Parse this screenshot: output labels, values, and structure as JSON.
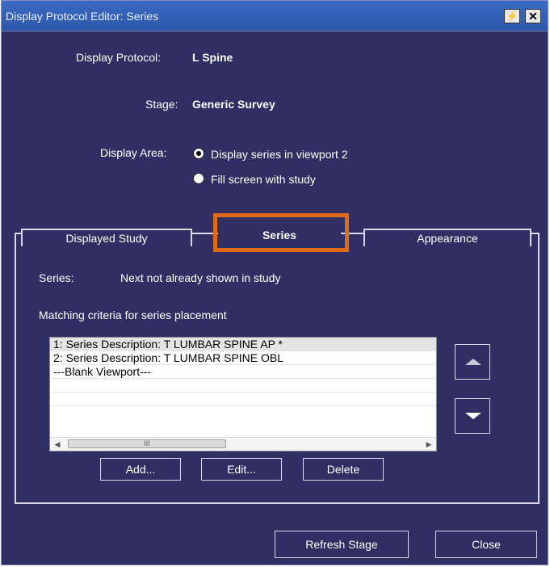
{
  "window": {
    "title": "Display Protocol Editor: Series",
    "help_glyph": "⚡",
    "close_glyph": "✕"
  },
  "protocol": {
    "display_protocol_label": "Display Protocol:",
    "display_protocol_value": "L Spine",
    "stage_label": "Stage:",
    "stage_value": "Generic Survey",
    "display_area_label": "Display Area:",
    "options": [
      {
        "label": "Display series in viewport 2",
        "selected": true
      },
      {
        "label": "Fill screen with study",
        "selected": false
      }
    ]
  },
  "tabs": [
    {
      "label": "Displayed Study",
      "active": false
    },
    {
      "label": "Series",
      "active": true
    },
    {
      "label": "Appearance",
      "active": false
    }
  ],
  "series_panel": {
    "series_label": "Series:",
    "series_value": "Next not already shown in study",
    "criteria_heading": "Matching criteria for series placement",
    "list_items": [
      "1: Series Description: T LUMBAR SPINE AP *",
      "2: Series Description: T LUMBAR SPINE OBL",
      "---Blank Viewport---",
      "",
      ""
    ],
    "scroll_thumb_glyph": "III",
    "buttons": {
      "add": "Add...",
      "edit": "Edit...",
      "delete": "Delete"
    }
  },
  "footer": {
    "refresh": "Refresh Stage",
    "close": "Close"
  },
  "colors": {
    "background": "#2f2f64",
    "highlight": "#e06b15",
    "titlebar": "#2d57aa"
  }
}
